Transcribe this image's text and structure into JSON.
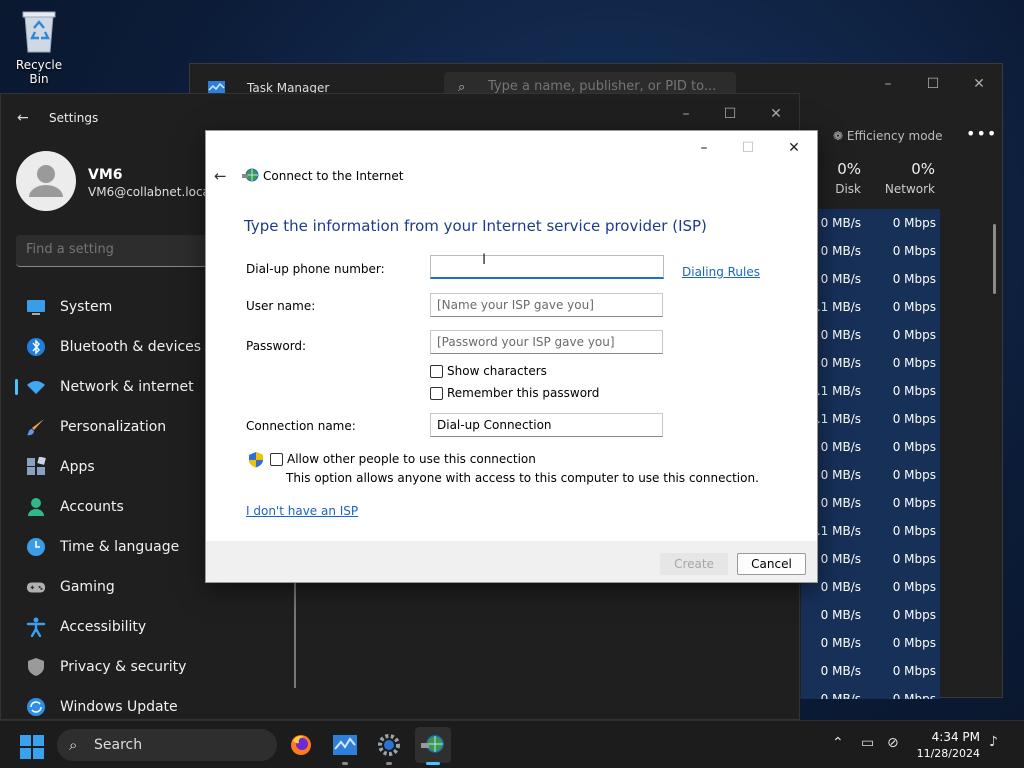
{
  "desktop": {
    "recycle_bin_label": "Recycle Bin"
  },
  "task_manager": {
    "title": "Task Manager",
    "search_placeholder": "Type a name, publisher, or PID to...",
    "efficiency_mode_label": "Efficiency mode",
    "more_label": "•••",
    "columns": [
      {
        "percent": "0%",
        "name": "Disk"
      },
      {
        "percent": "0%",
        "name": "Network"
      }
    ],
    "rows": [
      {
        "disk": "0 MB/s",
        "net": "0 Mbps"
      },
      {
        "disk": "0 MB/s",
        "net": "0 Mbps"
      },
      {
        "disk": "0 MB/s",
        "net": "0 Mbps"
      },
      {
        "disk": "0.1 MB/s",
        "net": "0 Mbps"
      },
      {
        "disk": "0 MB/s",
        "net": "0 Mbps"
      },
      {
        "disk": "0 MB/s",
        "net": "0 Mbps"
      },
      {
        "disk": "0.1 MB/s",
        "net": "0 Mbps"
      },
      {
        "disk": "0.1 MB/s",
        "net": "0 Mbps"
      },
      {
        "disk": "0 MB/s",
        "net": "0 Mbps"
      },
      {
        "disk": "0 MB/s",
        "net": "0 Mbps"
      },
      {
        "disk": "0 MB/s",
        "net": "0 Mbps"
      },
      {
        "disk": "0.1 MB/s",
        "net": "0 Mbps"
      },
      {
        "disk": "0 MB/s",
        "net": "0 Mbps"
      },
      {
        "disk": "0 MB/s",
        "net": "0 Mbps"
      },
      {
        "disk": "0 MB/s",
        "net": "0 Mbps"
      },
      {
        "disk": "0 MB/s",
        "net": "0 Mbps"
      },
      {
        "disk": "0 MB/s",
        "net": "0 Mbps"
      },
      {
        "disk": "0 MB/s",
        "net": "0 Mbps"
      }
    ]
  },
  "settings": {
    "title": "Settings",
    "user_name": "VM6",
    "user_email": "VM6@collabnet.local",
    "find_placeholder": "Find a setting",
    "nav": [
      {
        "label": "System",
        "icon": "system-icon",
        "color": "#3a9de8"
      },
      {
        "label": "Bluetooth & devices",
        "icon": "bluetooth-icon",
        "color": "#1f7fe0"
      },
      {
        "label": "Network & internet",
        "icon": "wifi-icon",
        "color": "#3fa8f0",
        "active": true
      },
      {
        "label": "Personalization",
        "icon": "brush-icon",
        "color": "#e8a35a"
      },
      {
        "label": "Apps",
        "icon": "apps-icon",
        "color": "#8aa0c0"
      },
      {
        "label": "Accounts",
        "icon": "accounts-icon",
        "color": "#2fb88a"
      },
      {
        "label": "Time & language",
        "icon": "clock-icon",
        "color": "#3a9de8"
      },
      {
        "label": "Gaming",
        "icon": "gamepad-icon",
        "color": "#b0b0b0"
      },
      {
        "label": "Accessibility",
        "icon": "accessibility-icon",
        "color": "#3aa0f0"
      },
      {
        "label": "Privacy & security",
        "icon": "shield-icon",
        "color": "#9a9a9a"
      },
      {
        "label": "Windows Update",
        "icon": "update-icon",
        "color": "#2e8fe8"
      }
    ]
  },
  "dialog": {
    "title": "Connect to the Internet",
    "heading": "Type the information from your Internet service provider (ISP)",
    "phone_label": "Dial-up phone number:",
    "phone_value": "",
    "dialing_rules_link": "Dialing Rules",
    "username_label": "User name:",
    "username_placeholder": "[Name your ISP gave you]",
    "password_label": "Password:",
    "password_placeholder": "[Password your ISP gave you]",
    "show_characters_label": "Show characters",
    "remember_password_label": "Remember this password",
    "connection_name_label": "Connection name:",
    "connection_name_value": "Dial-up Connection",
    "allow_others_label": "Allow other people to use this connection",
    "allow_others_note": "This option allows anyone with access to this computer to use this connection.",
    "no_isp_link": "I don't have an ISP",
    "create_label": "Create",
    "cancel_label": "Cancel"
  },
  "taskbar": {
    "search_label": "Search",
    "time": "4:34 PM",
    "date": "11/28/2024"
  }
}
